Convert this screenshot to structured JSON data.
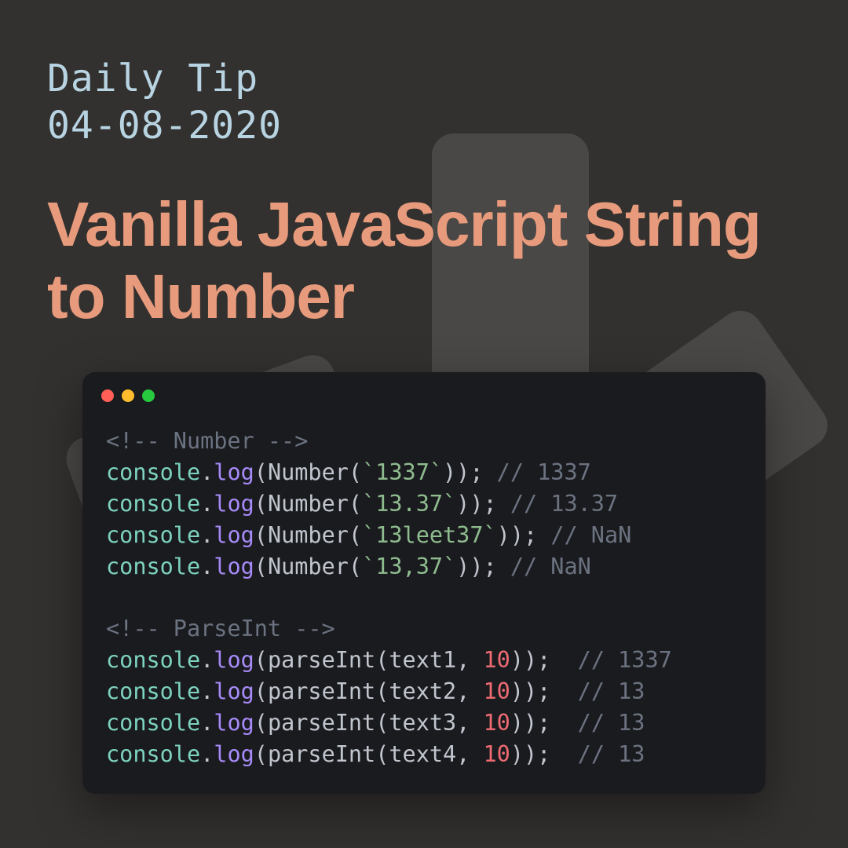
{
  "subtitle_line1": "Daily Tip",
  "subtitle_line2": "04-08-2020",
  "title": "Vanilla JavaScript String to Number",
  "code": {
    "comment1": "<!-- Number -->",
    "lines_number": [
      {
        "obj": "console",
        "method": "log",
        "func": "Number",
        "arg_str": "`1337`",
        "after": "",
        "comment": "// 1337"
      },
      {
        "obj": "console",
        "method": "log",
        "func": "Number",
        "arg_str": "`13.37`",
        "after": "",
        "comment": "// 13.37"
      },
      {
        "obj": "console",
        "method": "log",
        "func": "Number",
        "arg_str": "`13leet37`",
        "after": "",
        "comment": "// NaN"
      },
      {
        "obj": "console",
        "method": "log",
        "func": "Number",
        "arg_str": "`13,37`",
        "after": "",
        "comment": "// NaN"
      }
    ],
    "comment2": "<!-- ParseInt -->",
    "lines_parseint": [
      {
        "obj": "console",
        "method": "log",
        "func": "parseInt",
        "arg_var": "text1",
        "arg_num": "10",
        "comment": "// 1337"
      },
      {
        "obj": "console",
        "method": "log",
        "func": "parseInt",
        "arg_var": "text2",
        "arg_num": "10",
        "comment": "// 13"
      },
      {
        "obj": "console",
        "method": "log",
        "func": "parseInt",
        "arg_var": "text3",
        "arg_num": "10",
        "comment": "// 13"
      },
      {
        "obj": "console",
        "method": "log",
        "func": "parseInt",
        "arg_var": "text4",
        "arg_num": "10",
        "comment": "// 13"
      }
    ]
  }
}
